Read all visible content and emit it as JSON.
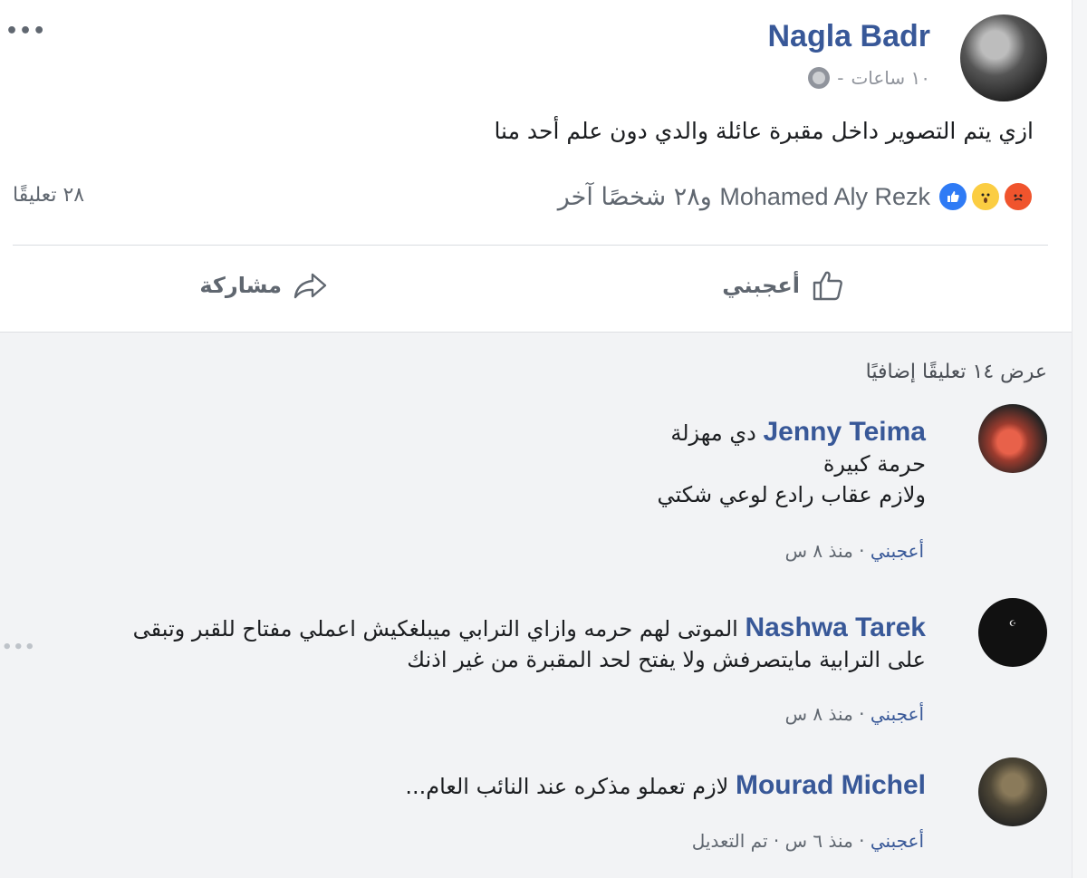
{
  "post": {
    "author": "Nagla Badr",
    "time": "١٠ ساعات",
    "separator": "-",
    "text": "ازي يتم التصوير داخل مقبرة عائلة والدي دون علم أحد منا",
    "more_menu": "•••",
    "reactions": {
      "icons": [
        "angry-reaction",
        "wow-reaction",
        "like-reaction"
      ],
      "names_bold": "Mohamed Aly Rezk",
      "names_rest": "و٢٨ شخصًا آخر"
    },
    "comments_count": "٢٨ تعليقًا",
    "actions": {
      "like": "أعجبني",
      "share": "مشاركة"
    }
  },
  "comments_section": {
    "view_more": "عرض ١٤ تعليقًا إضافيًا",
    "comments": [
      {
        "author": "Jenny Teima",
        "lines": [
          "دي مهزلة",
          "حرمة كبيرة",
          "ولازم عقاب رادع لوعي شكتي"
        ],
        "like_label": "أعجبني",
        "sep": "·",
        "time": "منذ ٨ س"
      },
      {
        "author": "Nashwa Tarek",
        "lines": [
          "الموتى لهم حرمه وازاي الترابي ميبلغكيش اعملي مفتاح للقبر وتبقى",
          "على الترابية مايتصرفش ولا يفتح لحد المقبرة من غير اذنك"
        ],
        "like_label": "أعجبني",
        "sep": "·",
        "time": "منذ ٨ س"
      },
      {
        "author": "Mourad Michel",
        "lines": [
          "لازم تعملو مذكره عند النائب العام..."
        ],
        "like_label": "أعجبني",
        "sep": "·",
        "time": "منذ ٦ س",
        "edited": "تم التعديل"
      }
    ]
  },
  "colors": {
    "link_blue": "#385898",
    "meta_gray": "#90949c",
    "text_dark": "#1c1e21",
    "bubble_bg": "#f2f3f5",
    "like_blue": "#2f7bf5",
    "angry_orange": "#f0542d",
    "wow_yellow": "#fbcd42"
  }
}
